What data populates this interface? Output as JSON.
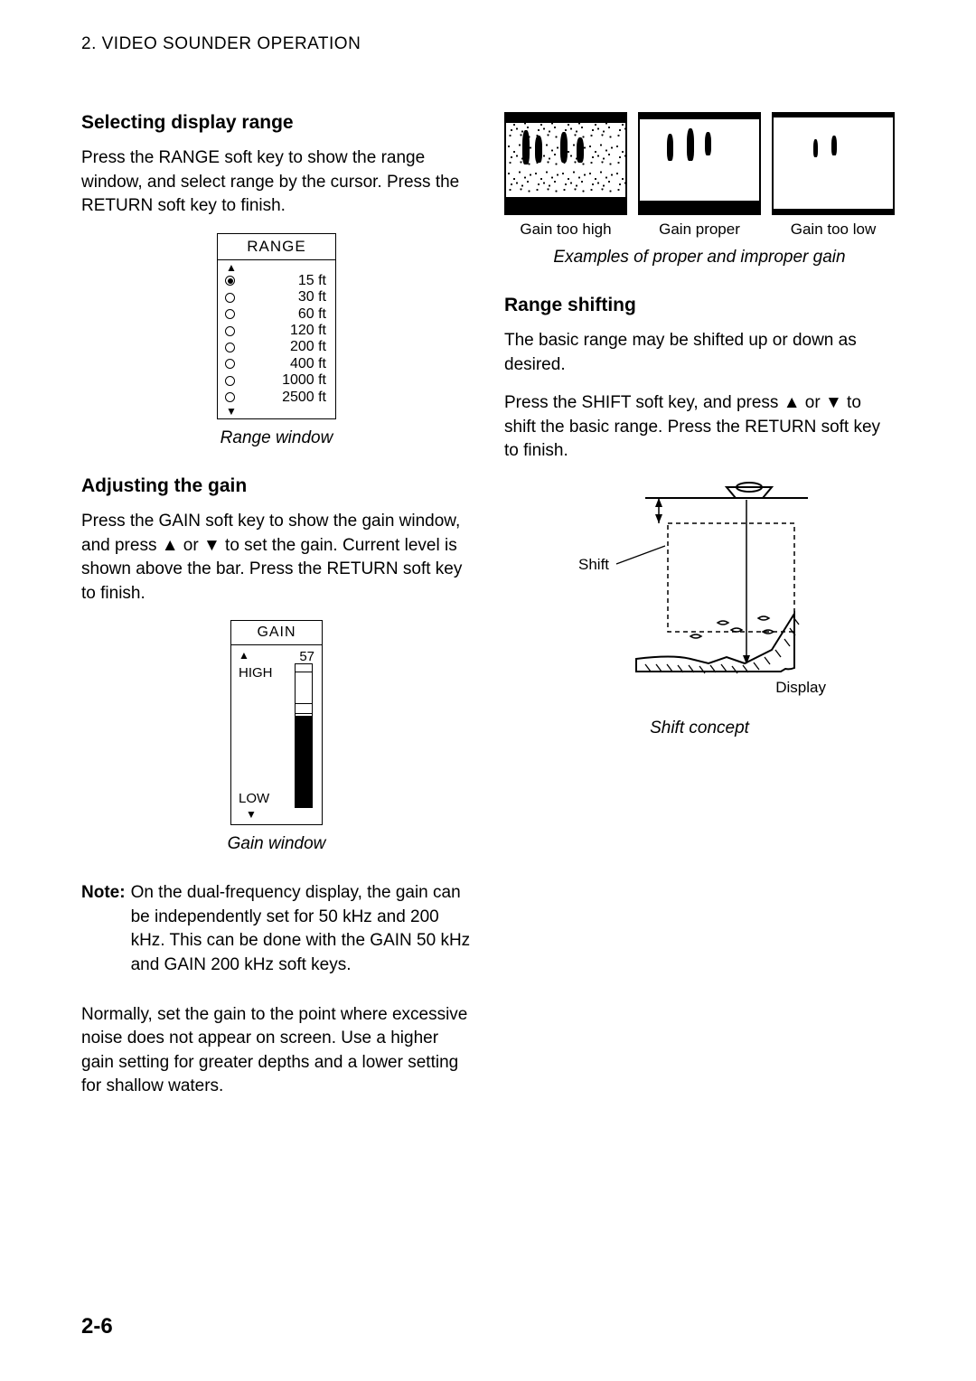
{
  "header": "2. VIDEO SOUNDER OPERATION",
  "left": {
    "h1": "Selecting display range",
    "p1": "Press the RANGE soft key to show the range window, and select range by the cursor. Press the RETURN soft key to finish.",
    "range_window": {
      "title": "RANGE",
      "items": [
        {
          "label": "15 ft",
          "selected": true
        },
        {
          "label": "30 ft",
          "selected": false
        },
        {
          "label": "60 ft",
          "selected": false
        },
        {
          "label": "120 ft",
          "selected": false
        },
        {
          "label": "200 ft",
          "selected": false
        },
        {
          "label": "400 ft",
          "selected": false
        },
        {
          "label": "1000 ft",
          "selected": false
        },
        {
          "label": "2500 ft",
          "selected": false
        }
      ]
    },
    "caption1": "Range window",
    "h2": "Adjusting the gain",
    "p2": "Press the GAIN soft key to show the gain window, and press ▲ or ▼ to set the gain. Current level is shown above the bar. Press the RETURN soft key to finish.",
    "gain_window": {
      "title": "GAIN",
      "value": "57",
      "high": "HIGH",
      "low": "LOW",
      "fill_percent": 65
    },
    "caption2": "Gain window",
    "note_label": "Note:",
    "note_body": "On the dual-frequency display, the gain can be independently set for 50 kHz and 200 kHz. This can be done with the GAIN 50 kHz and GAIN 200 kHz soft keys.",
    "p3": "Normally, set the gain to the point where excessive noise does not appear on screen. Use a higher gain setting for greater depths and a lower setting for shallow waters."
  },
  "right": {
    "examples": {
      "labels": [
        "Gain too high",
        "Gain proper",
        "Gain too low"
      ]
    },
    "caption3": "Examples of proper and improper gain",
    "h3": "Range shifting",
    "p4": "The basic range may be shifted up or down as desired.",
    "p5": "Press the SHIFT soft key, and press ▲ or ▼ to shift the basic range. Press the RETURN soft key to finish.",
    "shift_labels": {
      "shift": "Shift",
      "display": "Display"
    },
    "caption4": "Shift concept"
  },
  "page_number": "2-6"
}
